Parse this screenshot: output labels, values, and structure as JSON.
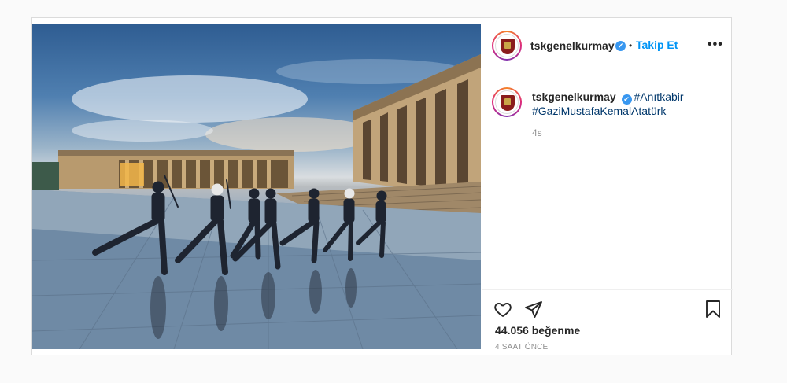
{
  "post": {
    "image_alt": "Soldiers marching at Anıtkabir",
    "header": {
      "username": "tskgenelkurmay",
      "verified_mark": "✔",
      "separator": "•",
      "follow_label": "Takip Et",
      "more_label": "•••"
    },
    "caption": {
      "username": "tskgenelkurmay",
      "tags": [
        "#Anıtkabir",
        "#GaziMustafaKemalAtatürk"
      ],
      "relative_time": "4s"
    },
    "footer": {
      "likes": "44.056 beğenme",
      "posted_ago": "4 SAAT ÖNCE"
    }
  },
  "icons": {
    "like": "heart-icon",
    "share": "paper-plane-icon",
    "save": "bookmark-icon",
    "verified": "verified-badge-icon",
    "more": "more-options-icon"
  },
  "colors": {
    "follow_link": "#0095f6",
    "verified_badge": "#3897f0",
    "hashtag": "#00376b",
    "muted_text": "#8e8e8e",
    "border": "#dbdbdb"
  }
}
